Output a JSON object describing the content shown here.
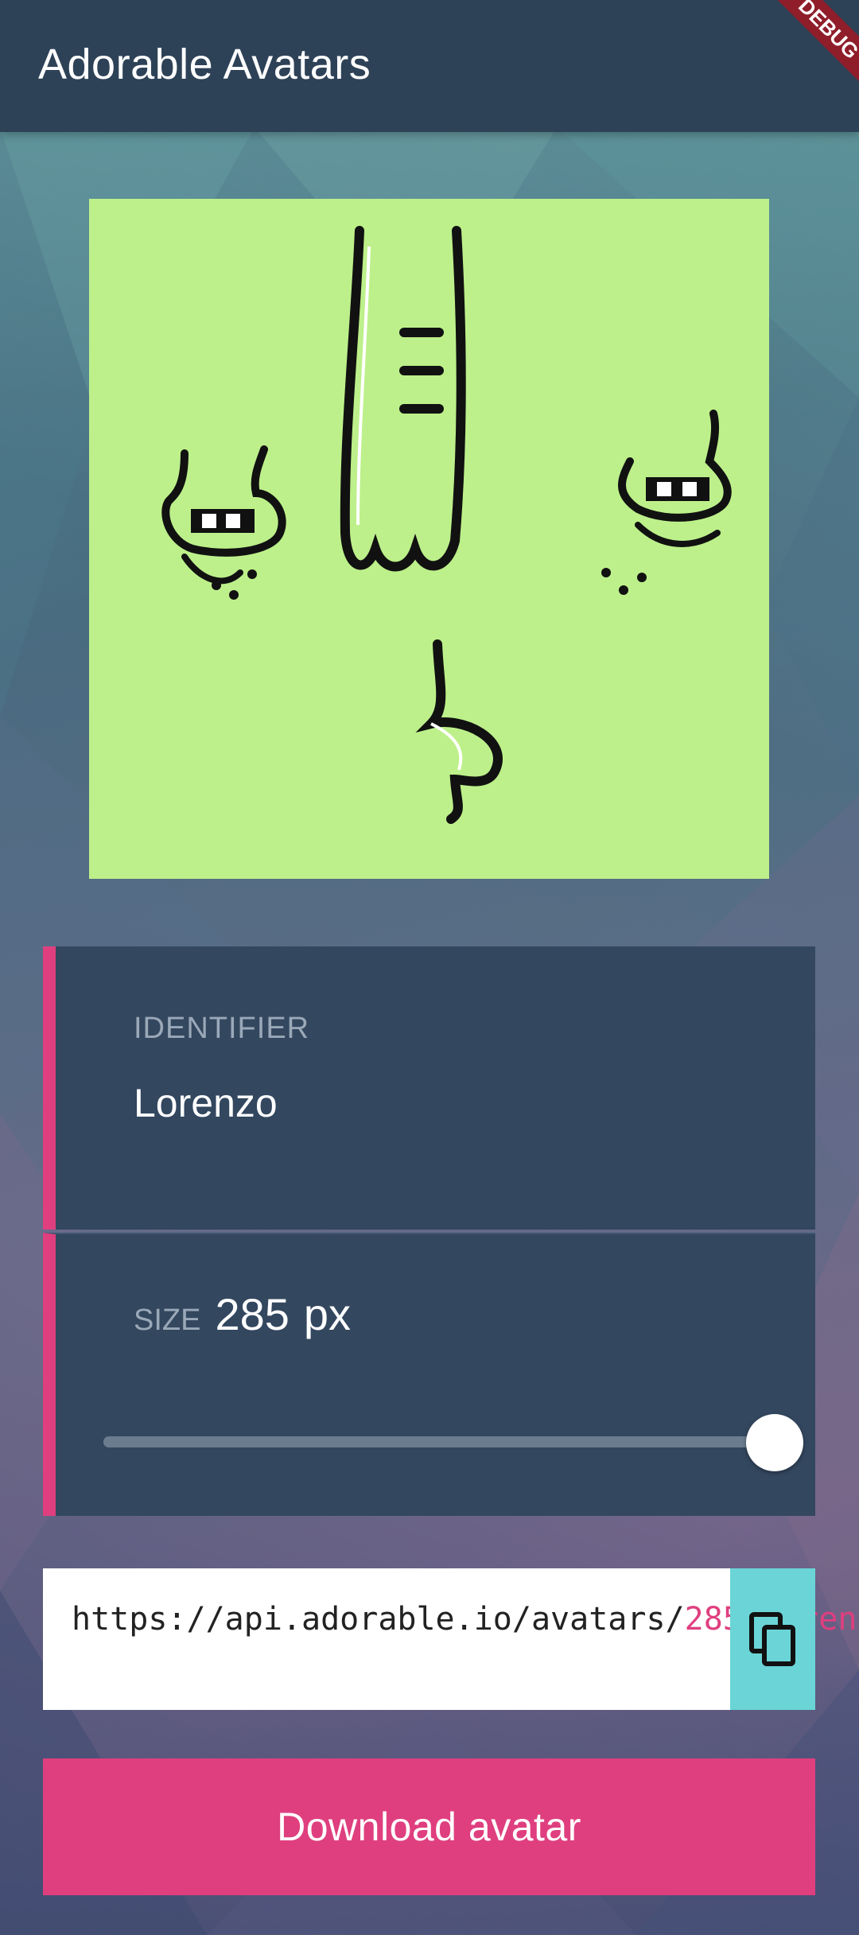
{
  "app": {
    "title": "Adorable Avatars",
    "debug_banner": "DEBUG"
  },
  "identifier": {
    "label": "IDENTIFIER",
    "value": "Lorenzo"
  },
  "size": {
    "label": "SIZE",
    "value": "285",
    "unit": "px",
    "slider_fraction": 1.0
  },
  "url": {
    "base": "https://api.adorable.io/avatars",
    "sep1": "/",
    "size": "285",
    "sep2": "/",
    "identifier": "Lorenzo"
  },
  "actions": {
    "copy_icon": "copy-icon",
    "download_label": "Download avatar"
  },
  "colors": {
    "appbar": "#2e4257",
    "accent": "#df3f7f",
    "card": "#33475f",
    "avatar_bg": "#bdf08a",
    "copy_bg": "#6ad4d6"
  }
}
